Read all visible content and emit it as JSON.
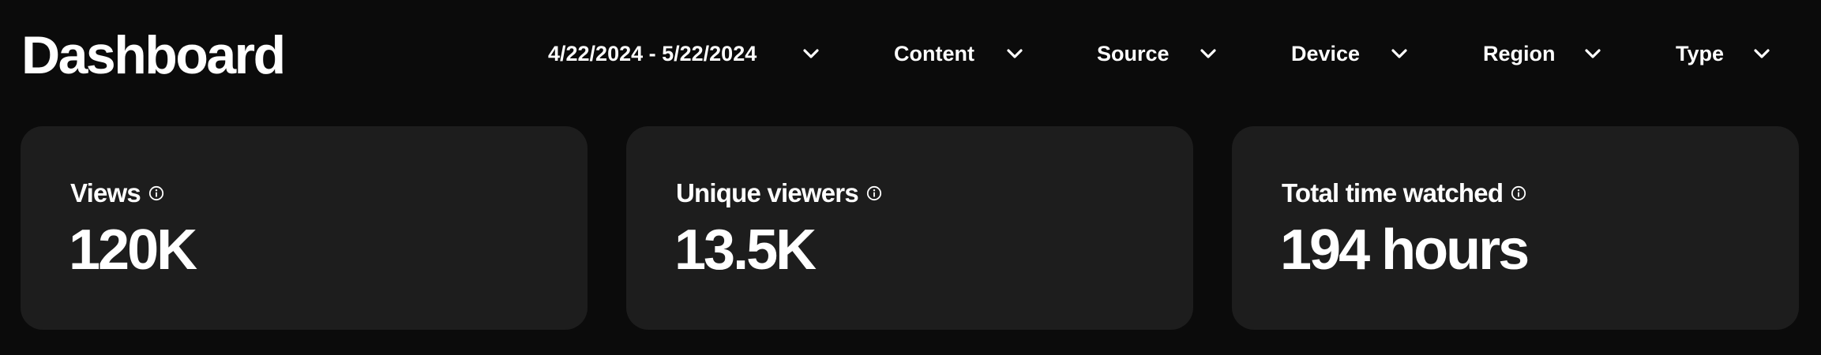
{
  "header": {
    "title": "Dashboard"
  },
  "filters": [
    {
      "label": "4/22/2024 - 5/22/2024",
      "icon": "chevron-down-icon"
    },
    {
      "label": "Content",
      "icon": "chevron-down-icon"
    },
    {
      "label": "Source",
      "icon": "chevron-down-icon"
    },
    {
      "label": "Device",
      "icon": "chevron-down-icon"
    },
    {
      "label": "Region",
      "icon": "chevron-down-icon"
    },
    {
      "label": "Type",
      "icon": "chevron-down-icon"
    }
  ],
  "metrics": [
    {
      "label": "Views",
      "value": "120K",
      "icon": "info-icon"
    },
    {
      "label": "Unique viewers",
      "value": "13.5K",
      "icon": "info-icon"
    },
    {
      "label": "Total time watched",
      "value": "194 hours",
      "icon": "info-icon"
    }
  ],
  "colors": {
    "background": "#0b0b0b",
    "card": "#1d1d1d",
    "text": "#ffffff"
  }
}
